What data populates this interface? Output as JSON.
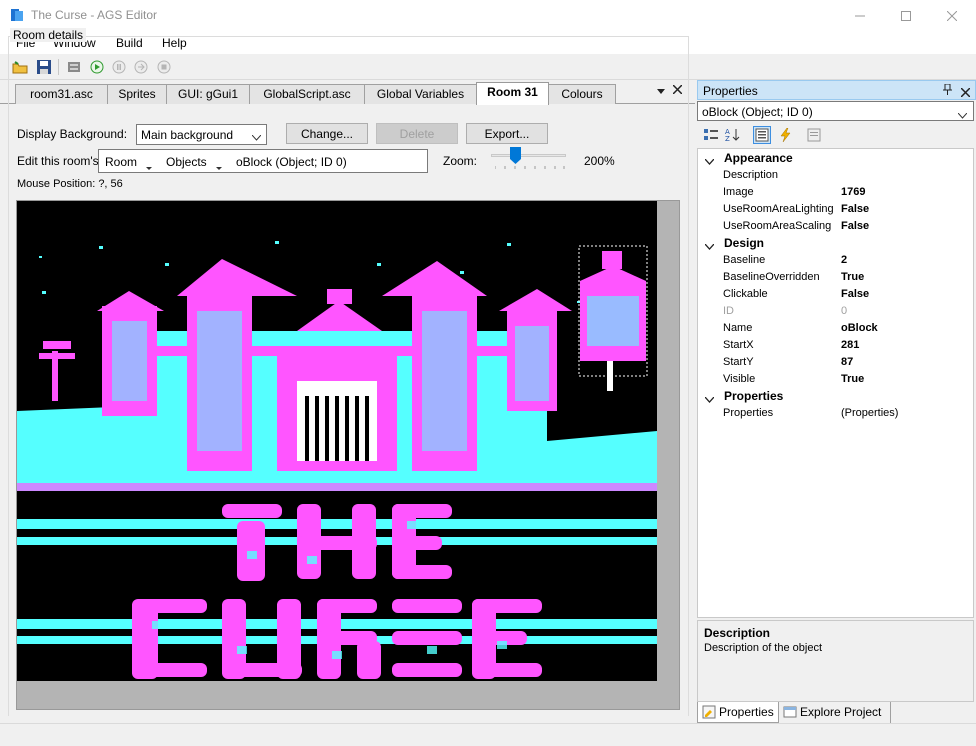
{
  "window": {
    "title": "The Curse - AGS Editor"
  },
  "menu": {
    "items": [
      "File",
      "Window",
      "Build",
      "Help"
    ]
  },
  "tabs": {
    "items": [
      "room31.asc",
      "Sprites",
      "GUI: gGui1",
      "GlobalScript.asc",
      "Global Variables",
      "Room 31",
      "Colours"
    ],
    "active": "Room 31"
  },
  "room": {
    "group_title": "Room details",
    "display_bg_label": "Display Background:",
    "display_bg_value": "Main background",
    "change_label": "Change...",
    "delete_label": "Delete",
    "export_label": "Export...",
    "edit_label": "Edit this room's:",
    "crumb_room": "Room",
    "crumb_objects": "Objects",
    "crumb_selected": "oBlock (Object; ID 0)",
    "zoom_label": "Zoom:",
    "zoom_value": "200%",
    "zoom_level": 200,
    "mouse_position": "Mouse Position: ?, 56"
  },
  "properties": {
    "header": "Properties",
    "selected_object": "oBlock (Object; ID 0)",
    "categories": [
      {
        "name": "Appearance",
        "rows": [
          {
            "name": "Description",
            "value": ""
          },
          {
            "name": "Image",
            "value": "1769"
          },
          {
            "name": "UseRoomAreaLighting",
            "value": "False"
          },
          {
            "name": "UseRoomAreaScaling",
            "value": "False"
          }
        ]
      },
      {
        "name": "Design",
        "rows": [
          {
            "name": "Baseline",
            "value": "2"
          },
          {
            "name": "BaselineOverridden",
            "value": "True"
          },
          {
            "name": "Clickable",
            "value": "False"
          },
          {
            "name": "ID",
            "value": "0"
          },
          {
            "name": "Name",
            "value": "oBlock"
          },
          {
            "name": "StartX",
            "value": "281"
          },
          {
            "name": "StartY",
            "value": "87"
          },
          {
            "name": "Visible",
            "value": "True"
          }
        ]
      },
      {
        "name": "Properties",
        "rows": [
          {
            "name": "Properties",
            "value": "(Properties)"
          }
        ]
      }
    ],
    "description_title": "Description",
    "description_text": "Description of the object",
    "bottom_tabs": [
      "Properties",
      "Explore Project"
    ]
  },
  "colors": {
    "magenta": "#ff55ff",
    "cyan": "#55ffff",
    "black": "#000000",
    "white": "#ffffff",
    "accent": "#cce4f7"
  }
}
